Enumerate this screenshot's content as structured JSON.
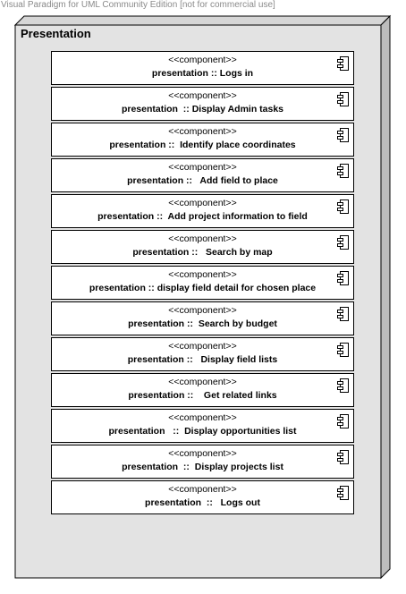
{
  "watermark": "Visual Paradigm for UML Community Edition [not for commercial use]",
  "node": {
    "title": "Presentation"
  },
  "components": [
    {
      "stereotype": "<<component>>",
      "name": "presentation :: Logs in"
    },
    {
      "stereotype": "<<component>>",
      "name": "presentation  :: Display Admin tasks"
    },
    {
      "stereotype": "<<component>>",
      "name": "presentation ::  Identify place coordinates"
    },
    {
      "stereotype": "<<component>>",
      "name": "presentation ::   Add field to place"
    },
    {
      "stereotype": "<<component>>",
      "name": "presentation ::  Add project information to field"
    },
    {
      "stereotype": "<<component>>",
      "name": "presentation ::   Search by map"
    },
    {
      "stereotype": "<<component>>",
      "name": "presentation :: display field detail for chosen place"
    },
    {
      "stereotype": "<<component>>",
      "name": "presentation ::  Search by budget"
    },
    {
      "stereotype": "<<component>>",
      "name": "presentation ::   Display field lists"
    },
    {
      "stereotype": "<<component>>",
      "name": "presentation ::    Get related links"
    },
    {
      "stereotype": "<<component>>",
      "name": "presentation   ::  Display opportunities list"
    },
    {
      "stereotype": "<<component>>",
      "name": "presentation  ::  Display projects list"
    },
    {
      "stereotype": "<<component>>",
      "name": "presentation  ::   Logs out"
    }
  ],
  "icons": {
    "component": "component-icon"
  }
}
